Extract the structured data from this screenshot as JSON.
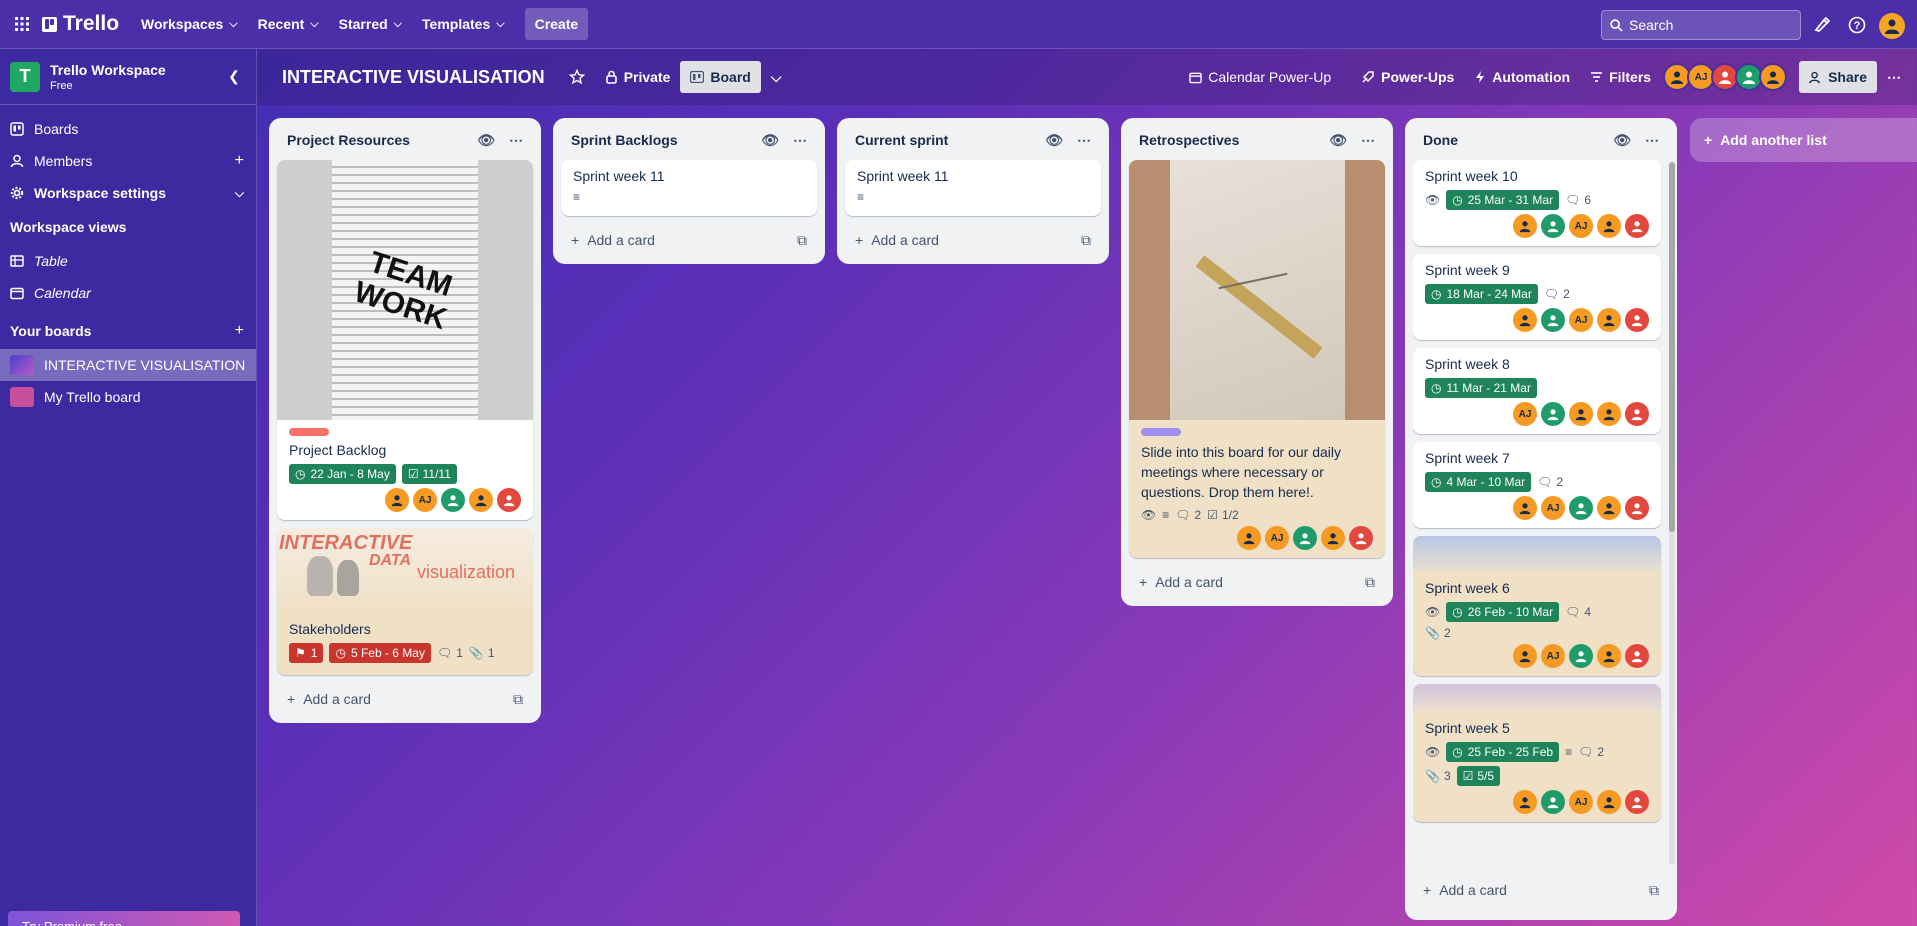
{
  "topbar": {
    "logo": "Trello",
    "nav": [
      "Workspaces",
      "Recent",
      "Starred",
      "Templates"
    ],
    "create_label": "Create",
    "search_placeholder": "Search"
  },
  "sidebar": {
    "workspace_initial": "T",
    "workspace_name": "Trello Workspace",
    "workspace_plan": "Free",
    "items": [
      {
        "label": "Boards"
      },
      {
        "label": "Members"
      },
      {
        "label": "Workspace settings"
      }
    ],
    "views_heading": "Workspace views",
    "views": [
      {
        "label": "Table"
      },
      {
        "label": "Calendar"
      }
    ],
    "your_boards_heading": "Your boards",
    "boards": [
      {
        "label": "INTERACTIVE VISUALISATION",
        "color": "#7b5ce0"
      },
      {
        "label": "My Trello board",
        "color": "#c64f9e"
      }
    ],
    "premium_label": "Try Premium free"
  },
  "board": {
    "title": "INTERACTIVE VISUALISATION",
    "visibility": "Private",
    "view": "Board",
    "calendar_powerup": "Calendar Power-Up",
    "powerups": "Power-Ups",
    "automation": "Automation",
    "filters": "Filters",
    "member_initials": "AJ",
    "share": "Share"
  },
  "lists": {
    "resources": {
      "title": "Project Resources",
      "card1_image_text_1": "TEAM",
      "card1_image_text_2": "WORK",
      "card1_title": "Project Backlog",
      "card1_date": "22 Jan - 8 May",
      "card1_checklist": "11/11",
      "card2_image_text_1": "INTERACTIVE",
      "card2_image_text_2": "DATA",
      "card2_image_text_3": "visualization",
      "card2_title": "Stakeholders",
      "card2_flag": "1",
      "card2_date": "5 Feb - 6 May",
      "card2_comments": "1",
      "card2_attach": "1",
      "add_card": "Add a card"
    },
    "backlogs": {
      "title": "Sprint Backlogs",
      "card_title": "Sprint week 11",
      "add_card": "Add a card"
    },
    "current": {
      "title": "Current sprint",
      "card_title": "Sprint week 11",
      "add_card": "Add a card"
    },
    "retro": {
      "title": "Retrospectives",
      "card_title": "Slide into this board for our daily meetings where necessary or questions. Drop them here!.",
      "comments": "2",
      "checklist": "1/2",
      "add_card": "Add a card"
    },
    "done": {
      "title": "Done",
      "cards": [
        {
          "title": "Sprint week 10",
          "date": "25 Mar - 31 Mar",
          "comments": "6"
        },
        {
          "title": "Sprint week 9",
          "date": "18 Mar - 24 Mar",
          "comments": "2"
        },
        {
          "title": "Sprint week 8",
          "date": "11 Mar - 21 Mar"
        },
        {
          "title": "Sprint week 7",
          "date": "4 Mar - 10 Mar",
          "comments": "2"
        },
        {
          "title": "Sprint week 6",
          "date": "26 Feb - 10 Mar",
          "comments": "4",
          "attach": "2"
        },
        {
          "title": "Sprint week 5",
          "date": "25 Feb - 25 Feb",
          "comments": "2",
          "attach": "3",
          "checklist": "5/5"
        }
      ],
      "add_card": "Add a card"
    }
  },
  "add_list": "Add another list",
  "colors": {
    "date_green": "#1f845a",
    "date_red": "#c9372c",
    "label_red": "#f87168",
    "label_purple": "#9f8fef"
  }
}
